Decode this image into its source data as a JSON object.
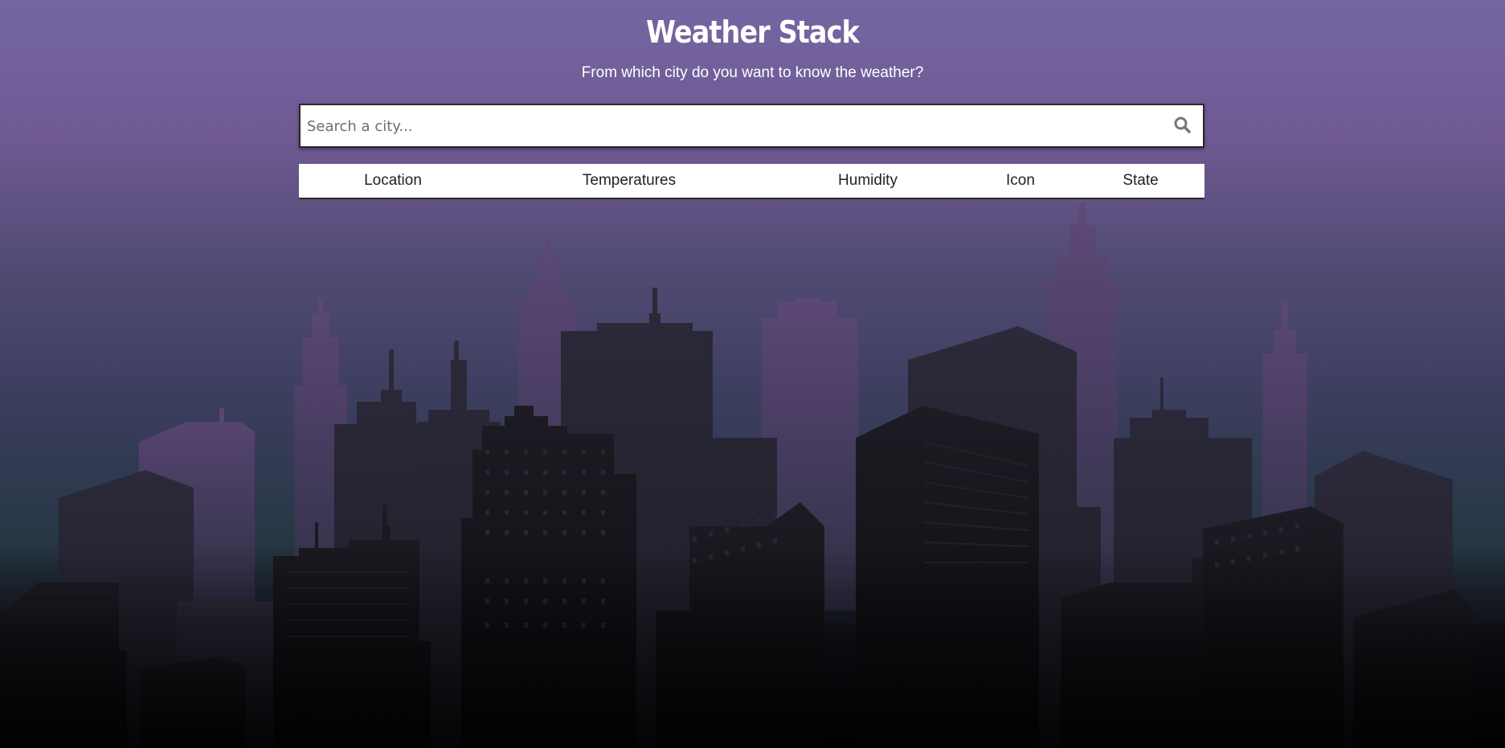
{
  "header": {
    "title": "Weather Stack",
    "subtitle": "From which city do you want to know the weather?"
  },
  "search": {
    "placeholder": "Search a city...",
    "value": "",
    "button_icon": "search-icon"
  },
  "table": {
    "columns": [
      "Location",
      "Temperatures",
      "Humidity",
      "Icon",
      "State"
    ]
  },
  "background": {
    "illustration": "city-skyline-silhouette",
    "colors": {
      "sky_top": "#7466a3",
      "sky_mid": "#3a3d5c",
      "ground": "#050507",
      "far_buildings": "#5a4574",
      "mid_buildings": "#2a2838",
      "near_buildings": "#16151c"
    }
  }
}
